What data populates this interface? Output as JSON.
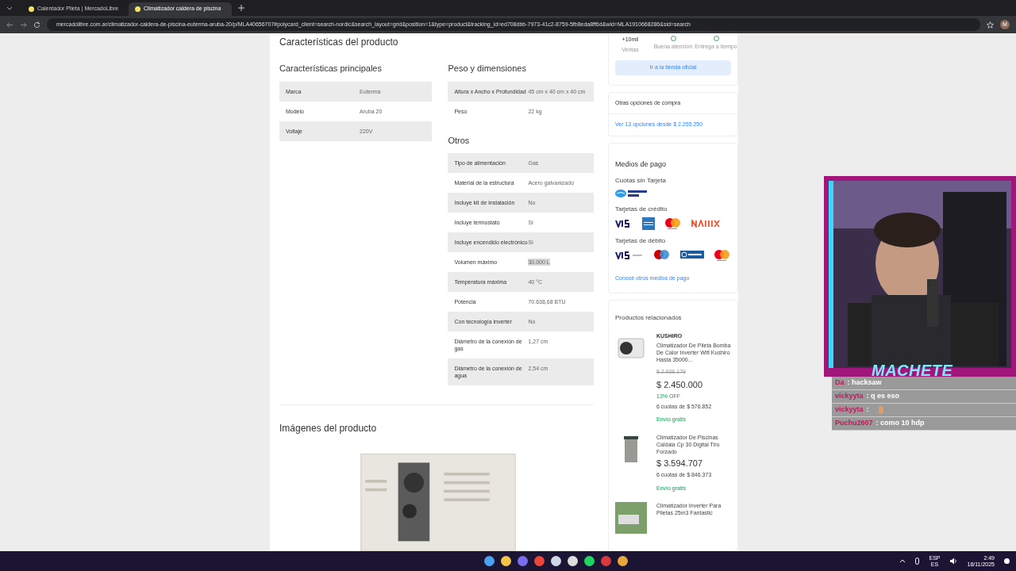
{
  "browser": {
    "tabs": [
      {
        "label": "Calentador Pileta | MercadoLibre",
        "selected": false
      },
      {
        "label": "Climatizador caldera de piscina",
        "selected": true
      }
    ],
    "url": "mercadolibre.com.ar/climatizador-caldera-de-piscina-euterma-aruba-20/p/MLA40656707#polycard_client=search-nordic&search_layout=grid&position=1&type=product&tracking_id=ed708dbb-7973-41c2-8759-5fb8eda8ff6d&wid=MLA1910668286&sid=search",
    "profile": "M"
  },
  "specs": {
    "title": "Características del producto",
    "groups_left": [
      {
        "title": "Características principales",
        "rows": [
          {
            "label": "Marca",
            "value": "Euterma"
          },
          {
            "label": "Modelo",
            "value": "Aruba 20"
          },
          {
            "label": "Voltaje",
            "value": "220V"
          }
        ]
      }
    ],
    "groups_right": [
      {
        "title": "Peso y dimensiones",
        "rows": [
          {
            "label": "Altura x Ancho x Profundidad",
            "value": "45 cm x 40 cm x 40 cm"
          },
          {
            "label": "Peso",
            "value": "22 kg"
          }
        ]
      },
      {
        "title": "Otros",
        "rows": [
          {
            "label": "Tipo de alimentación",
            "value": "Gas"
          },
          {
            "label": "Material de la estructura",
            "value": "Acero galvanizado"
          },
          {
            "label": "Incluye kit de instalación",
            "value": "No"
          },
          {
            "label": "Incluye termostato",
            "value": "Sí"
          },
          {
            "label": "Incluye encendido electrónico",
            "value": "Sí"
          },
          {
            "label": "Volumen máximo",
            "value": "30.000 L",
            "highlighted": true
          },
          {
            "label": "Temperatura máxima",
            "value": "40 °C"
          },
          {
            "label": "Potencia",
            "value": "70.638,68 BTU"
          },
          {
            "label": "Con tecnología inverter",
            "value": "No"
          },
          {
            "label": "Diámetro de la conexión de gas",
            "value": "1,27 cm"
          },
          {
            "label": "Diámetro de la conexión de agua",
            "value": "2,54 cm"
          }
        ]
      }
    ]
  },
  "images_section": {
    "title": "Imágenes del producto"
  },
  "seller": {
    "stats": [
      {
        "value": "+10mil",
        "label": "Ventas"
      },
      {
        "label": "Buena atención"
      },
      {
        "label": "Entrega a tiempo"
      }
    ],
    "button": "Ir a la tienda oficial"
  },
  "other_options": {
    "title": "Otras opciones de compra",
    "link": "Ver 13 opciones desde $ 2.255.250"
  },
  "payment": {
    "title": "Medios de pago",
    "groups": [
      {
        "title": "Cuotas sin Tarjeta",
        "logos": [
          {
            "kind": "mercadopago"
          }
        ]
      },
      {
        "title": "Tarjetas de crédito",
        "logos": [
          {
            "kind": "visa"
          },
          {
            "kind": "amex"
          },
          {
            "kind": "mastercard"
          },
          {
            "kind": "naranjax"
          }
        ]
      },
      {
        "title": "Tarjetas de débito",
        "logos": [
          {
            "kind": "visadebito"
          },
          {
            "kind": "maestro"
          },
          {
            "kind": "cabal"
          },
          {
            "kind": "mastercarddebito"
          }
        ]
      }
    ],
    "link": "Conocé otros medios de pago"
  },
  "related": {
    "title": "Productos relacionados",
    "items": [
      {
        "brand": "KUSHIRO",
        "title": "Climatizador De Pileta Bomba De Calor Inverter Wifi Kushiro Hasta 35000...",
        "old_price": "$ 2.636.179",
        "price": "$ 2.450.000",
        "discount": "13% OFF",
        "installments": "6 cuotas de $ 576.852",
        "shipping": "Envío gratis"
      },
      {
        "title": "Climatizador De Piscinas Caldaia Cp 30 Digital Tiro Forzado",
        "price": "$ 3.594.707",
        "installments": "6 cuotas de $ 846.373",
        "shipping": "Envío gratis"
      },
      {
        "title": "Climatizador Inverter Para Piletas 25m3 Fantastic"
      }
    ]
  },
  "stream": {
    "overlay_title": "MACHETE",
    "chat": [
      {
        "kind": "text",
        "user": "Da",
        "text": ": hacksaw"
      },
      {
        "kind": "text",
        "user": "vickyyta",
        "text": ": q es eso"
      },
      {
        "kind": "emote",
        "user": "vickyyta",
        "text": ":"
      },
      {
        "kind": "text",
        "user": "Puchu2607",
        "text": ": como 10 hdp"
      }
    ]
  },
  "taskbar": {
    "language": "ESP",
    "layout": "ES",
    "time": "2:49",
    "date": "18/11/2025"
  }
}
